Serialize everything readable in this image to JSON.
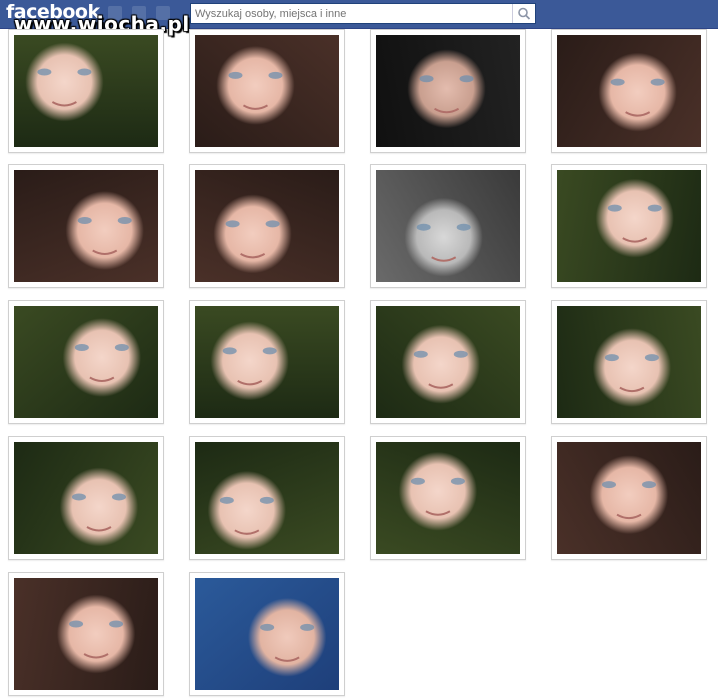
{
  "header": {
    "logo_text": "facebook",
    "watermark_text": "www.wiocha.pl",
    "bar_color": "#3b5998"
  },
  "search": {
    "placeholder": "Wyszukaj osoby, miejsca i inne",
    "icon": "search-icon"
  },
  "photos": [
    {
      "tone": "green"
    },
    {
      "tone": "warm"
    },
    {
      "tone": "dark"
    },
    {
      "tone": "warm"
    },
    {
      "tone": "warm"
    },
    {
      "tone": "warm"
    },
    {
      "tone": "gray"
    },
    {
      "tone": "green"
    },
    {
      "tone": "green"
    },
    {
      "tone": "green"
    },
    {
      "tone": "green"
    },
    {
      "tone": "green"
    },
    {
      "tone": "green"
    },
    {
      "tone": "green"
    },
    {
      "tone": "green"
    },
    {
      "tone": "warm"
    },
    {
      "tone": "warm"
    },
    {
      "tone": "blue"
    }
  ],
  "photo_icon": "photo-thumbnail"
}
